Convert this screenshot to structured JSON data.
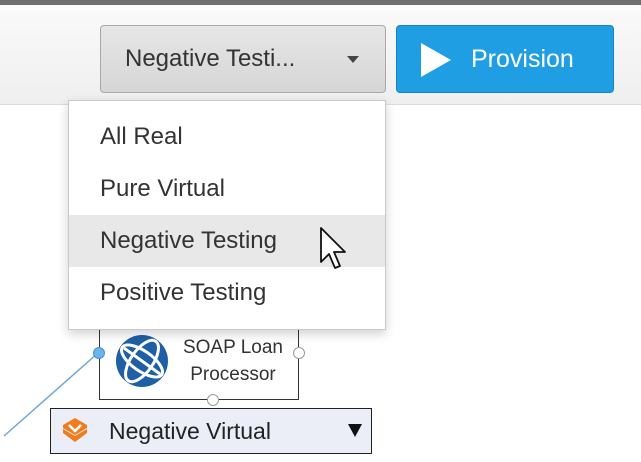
{
  "toolbar": {
    "config_select_value": "Negative Testi...",
    "provision_label": "Provision"
  },
  "dropdown": {
    "items": [
      {
        "label": "All Real"
      },
      {
        "label": "Pure Virtual"
      },
      {
        "label": "Negative Testing",
        "highlighted": true
      },
      {
        "label": "Positive Testing"
      }
    ]
  },
  "node": {
    "icon": "globe-icon",
    "label_line1": "SOAP Loan",
    "label_line2": "Processor"
  },
  "mode_select": {
    "icon": "virtual-service-icon",
    "value": "Negative Virtual"
  },
  "colors": {
    "provision": "#1f9ee3",
    "globe": "#1f5fa6",
    "mode_icon": "#f07c1e",
    "highlight": "#e8e8e8"
  }
}
